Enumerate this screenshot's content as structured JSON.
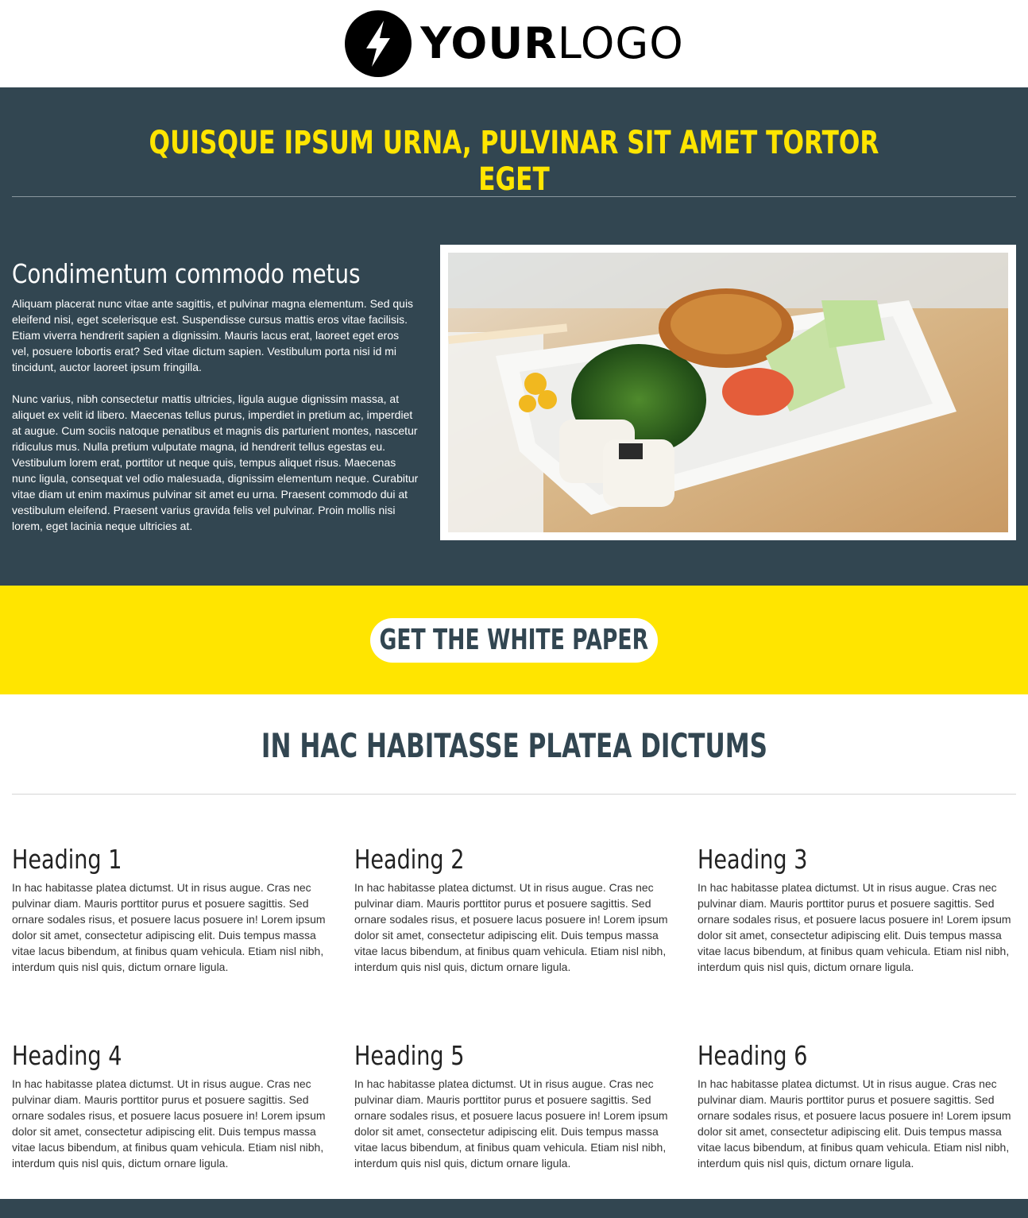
{
  "logo": {
    "text_bold": "YOUR",
    "text_light": "LOGO",
    "icon": "lightning-bolt-icon"
  },
  "hero": {
    "title": "QUISQUE IPSUM URNA, PULVINAR SIT AMET TORTOR EGET",
    "subheading": "Condimentum commodo metus",
    "paragraphs": [
      "Aliquam placerat nunc vitae ante sagittis, et pulvinar magna elementum. Sed quis eleifend nisi, eget scelerisque est. Suspendisse cursus mattis eros vitae facilisis. Etiam viverra hendrerit sapien a dignissim. Mauris lacus erat, laoreet eget eros vel, posuere lobortis erat? Sed vitae dictum sapien. Vestibulum porta nisi id mi tincidunt, auctor laoreet ipsum fringilla.",
      "Nunc varius, nibh consectetur mattis ultricies, ligula augue dignissim massa, at aliquet ex velit id libero. Maecenas tellus purus, imperdiet in pretium ac, imperdiet at augue. Cum sociis natoque penatibus et magnis dis parturient montes, nascetur ridiculus mus. Nulla pretium vulputate magna, id hendrerit tellus egestas eu. Vestibulum lorem erat, porttitor ut neque quis, tempus aliquet risus. Maecenas nunc ligula, consequat vel odio malesuada, dignissim elementum neque. Curabitur vitae diam ut enim maximus pulvinar sit amet eu urna. Praesent commodo dui at vestibulum eleifend. Praesent varius gravida felis vel pulvinar. Proin mollis nisi lorem, eget lacinia neque ultricies at."
    ]
  },
  "cta": {
    "label": "GET THE WHITE PAPER"
  },
  "features": {
    "title": "IN HAC HABITASSE PLATEA DICTUMS",
    "items": [
      {
        "heading": "Heading 1",
        "text": "In hac habitasse platea dictumst. Ut in risus augue. Cras nec pulvinar diam. Mauris porttitor purus et posuere sagittis. Sed ornare sodales risus, et posuere lacus posuere in! Lorem ipsum dolor sit amet, consectetur adipiscing elit. Duis tempus massa vitae lacus bibendum, at finibus quam vehicula. Etiam nisl nibh, interdum quis nisl quis, dictum ornare ligula."
      },
      {
        "heading": "Heading 2",
        "text": "In hac habitasse platea dictumst. Ut in risus augue. Cras nec pulvinar diam. Mauris porttitor purus et posuere sagittis. Sed ornare sodales risus, et posuere lacus posuere in! Lorem ipsum dolor sit amet, consectetur adipiscing elit. Duis tempus massa vitae lacus bibendum, at finibus quam vehicula. Etiam nisl nibh, interdum quis nisl quis, dictum ornare ligula."
      },
      {
        "heading": "Heading 3",
        "text": "In hac habitasse platea dictumst. Ut in risus augue. Cras nec pulvinar diam. Mauris porttitor purus et posuere sagittis. Sed ornare sodales risus, et posuere lacus posuere in! Lorem ipsum dolor sit amet, consectetur adipiscing elit. Duis tempus massa vitae lacus bibendum, at finibus quam vehicula. Etiam nisl nibh, interdum quis nisl quis, dictum ornare ligula."
      },
      {
        "heading": "Heading 4",
        "text": "In hac habitasse platea dictumst. Ut in risus augue. Cras nec pulvinar diam. Mauris porttitor purus et posuere sagittis. Sed ornare sodales risus, et posuere lacus posuere in! Lorem ipsum dolor sit amet, consectetur adipiscing elit. Duis tempus massa vitae lacus bibendum, at finibus quam vehicula. Etiam nisl nibh, interdum quis nisl quis, dictum ornare ligula."
      },
      {
        "heading": "Heading 5",
        "text": "In hac habitasse platea dictumst. Ut in risus augue. Cras nec pulvinar diam. Mauris porttitor purus et posuere sagittis. Sed ornare sodales risus, et posuere lacus posuere in! Lorem ipsum dolor sit amet, consectetur adipiscing elit. Duis tempus massa vitae lacus bibendum, at finibus quam vehicula. Etiam nisl nibh, interdum quis nisl quis, dictum ornare ligula."
      },
      {
        "heading": "Heading 6",
        "text": "In hac habitasse platea dictumst. Ut in risus augue. Cras nec pulvinar diam. Mauris porttitor purus et posuere sagittis. Sed ornare sodales risus, et posuere lacus posuere in! Lorem ipsum dolor sit amet, consectetur adipiscing elit. Duis tempus massa vitae lacus bibendum, at finibus quam vehicula. Etiam nisl nibh, interdum quis nisl quis, dictum ornare ligula."
      }
    ]
  },
  "colors": {
    "dark": "#324651",
    "accent": "#ffe500",
    "white": "#ffffff"
  }
}
